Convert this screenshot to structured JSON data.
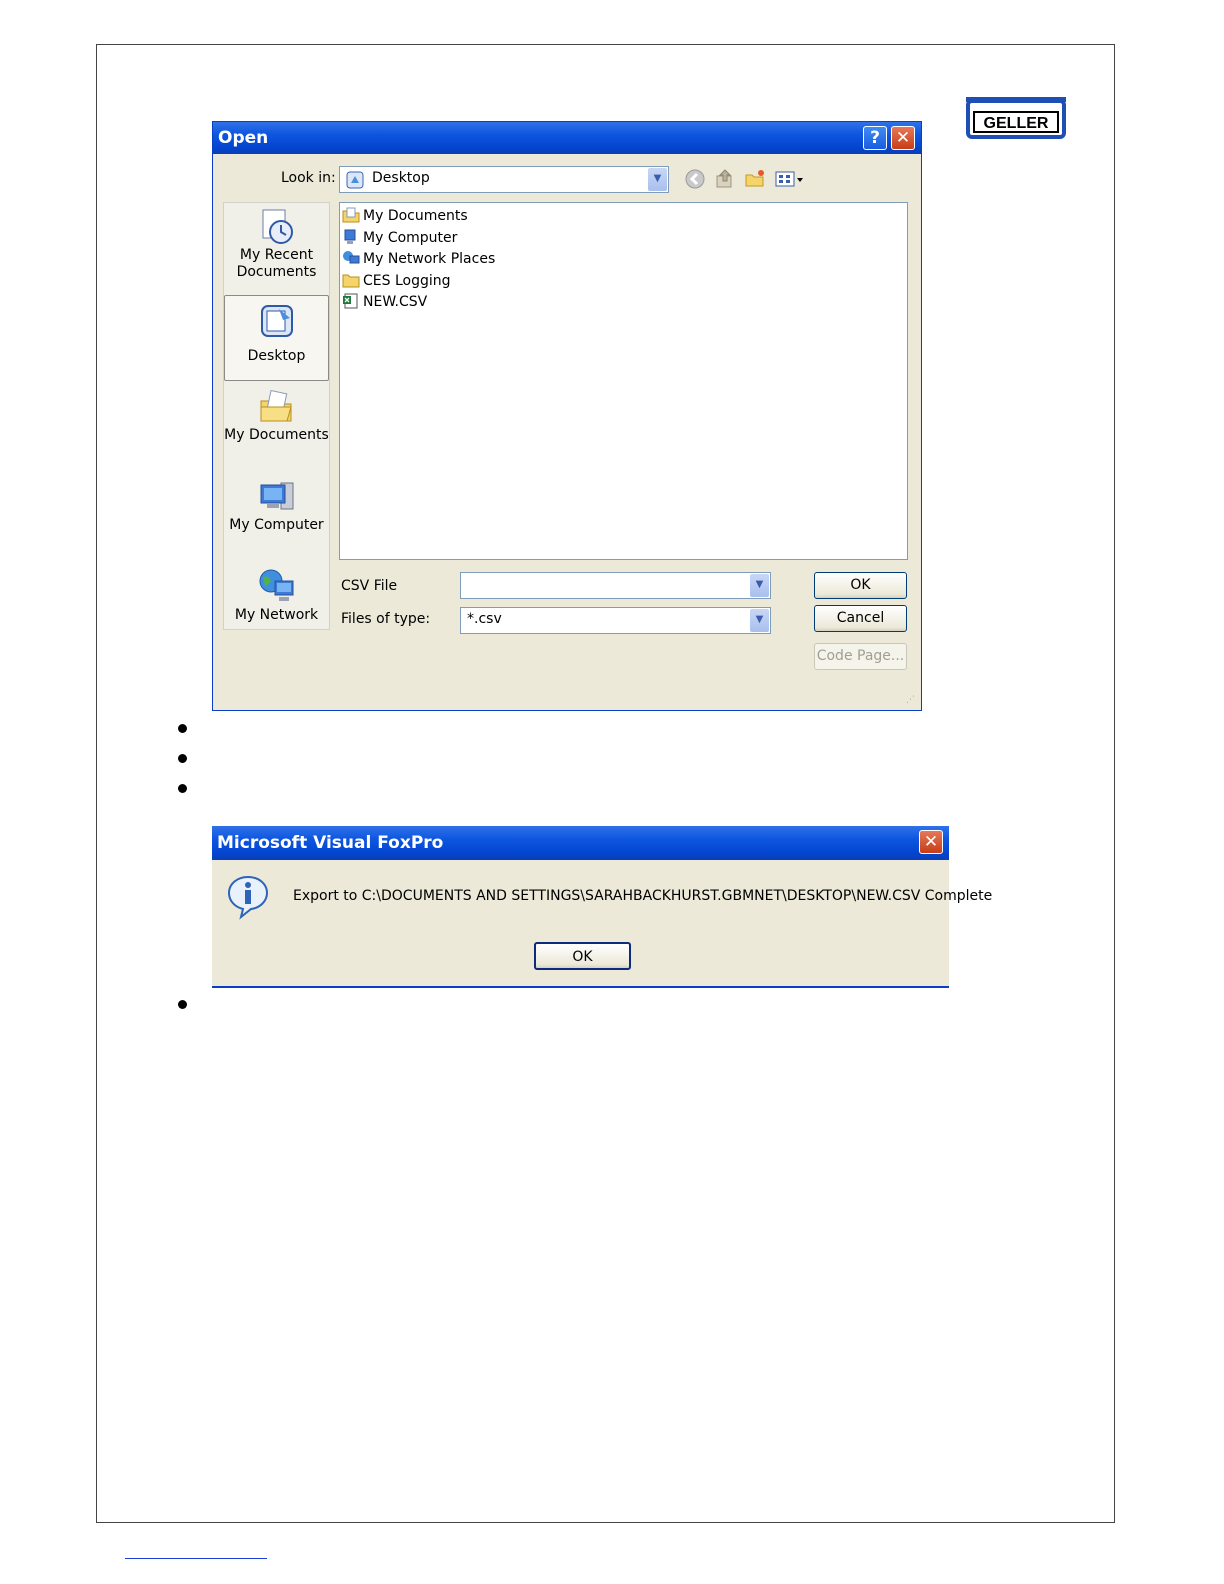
{
  "logo": {
    "text": "GELLER"
  },
  "open_dialog": {
    "title": "Open",
    "help_glyph": "?",
    "close_glyph": "✕",
    "look_in_label": "Look in:",
    "look_in_value": "Desktop",
    "places": [
      {
        "label_line1": "My Recent",
        "label_line2": "Documents",
        "icon": "recent-documents-icon"
      },
      {
        "label_line1": "Desktop",
        "label_line2": "",
        "icon": "desktop-icon"
      },
      {
        "label_line1": "My Documents",
        "label_line2": "",
        "icon": "my-documents-icon"
      },
      {
        "label_line1": "My Computer",
        "label_line2": "",
        "icon": "my-computer-icon"
      },
      {
        "label_line1": "My Network",
        "label_line2": "",
        "icon": "my-network-icon"
      }
    ],
    "files": [
      {
        "name": "My Documents",
        "icon": "folder-documents-icon"
      },
      {
        "name": "My Computer",
        "icon": "computer-icon"
      },
      {
        "name": "My Network Places",
        "icon": "network-icon"
      },
      {
        "name": "CES Logging",
        "icon": "folder-icon"
      },
      {
        "name": "NEW.CSV",
        "icon": "csv-file-icon"
      }
    ],
    "filename_label": "CSV File",
    "filename_value": "",
    "filetype_label": "Files of type:",
    "filetype_value": "*.csv",
    "ok_label": "OK",
    "cancel_label": "Cancel",
    "codepage_label": "Code Page..."
  },
  "message_dialog": {
    "title": "Microsoft Visual FoxPro",
    "close_glyph": "✕",
    "message": "Export to C:\\DOCUMENTS AND SETTINGS\\SARAHBACKHURST.GBMNET\\DESKTOP\\NEW.CSV Complete",
    "ok_label": "OK"
  }
}
